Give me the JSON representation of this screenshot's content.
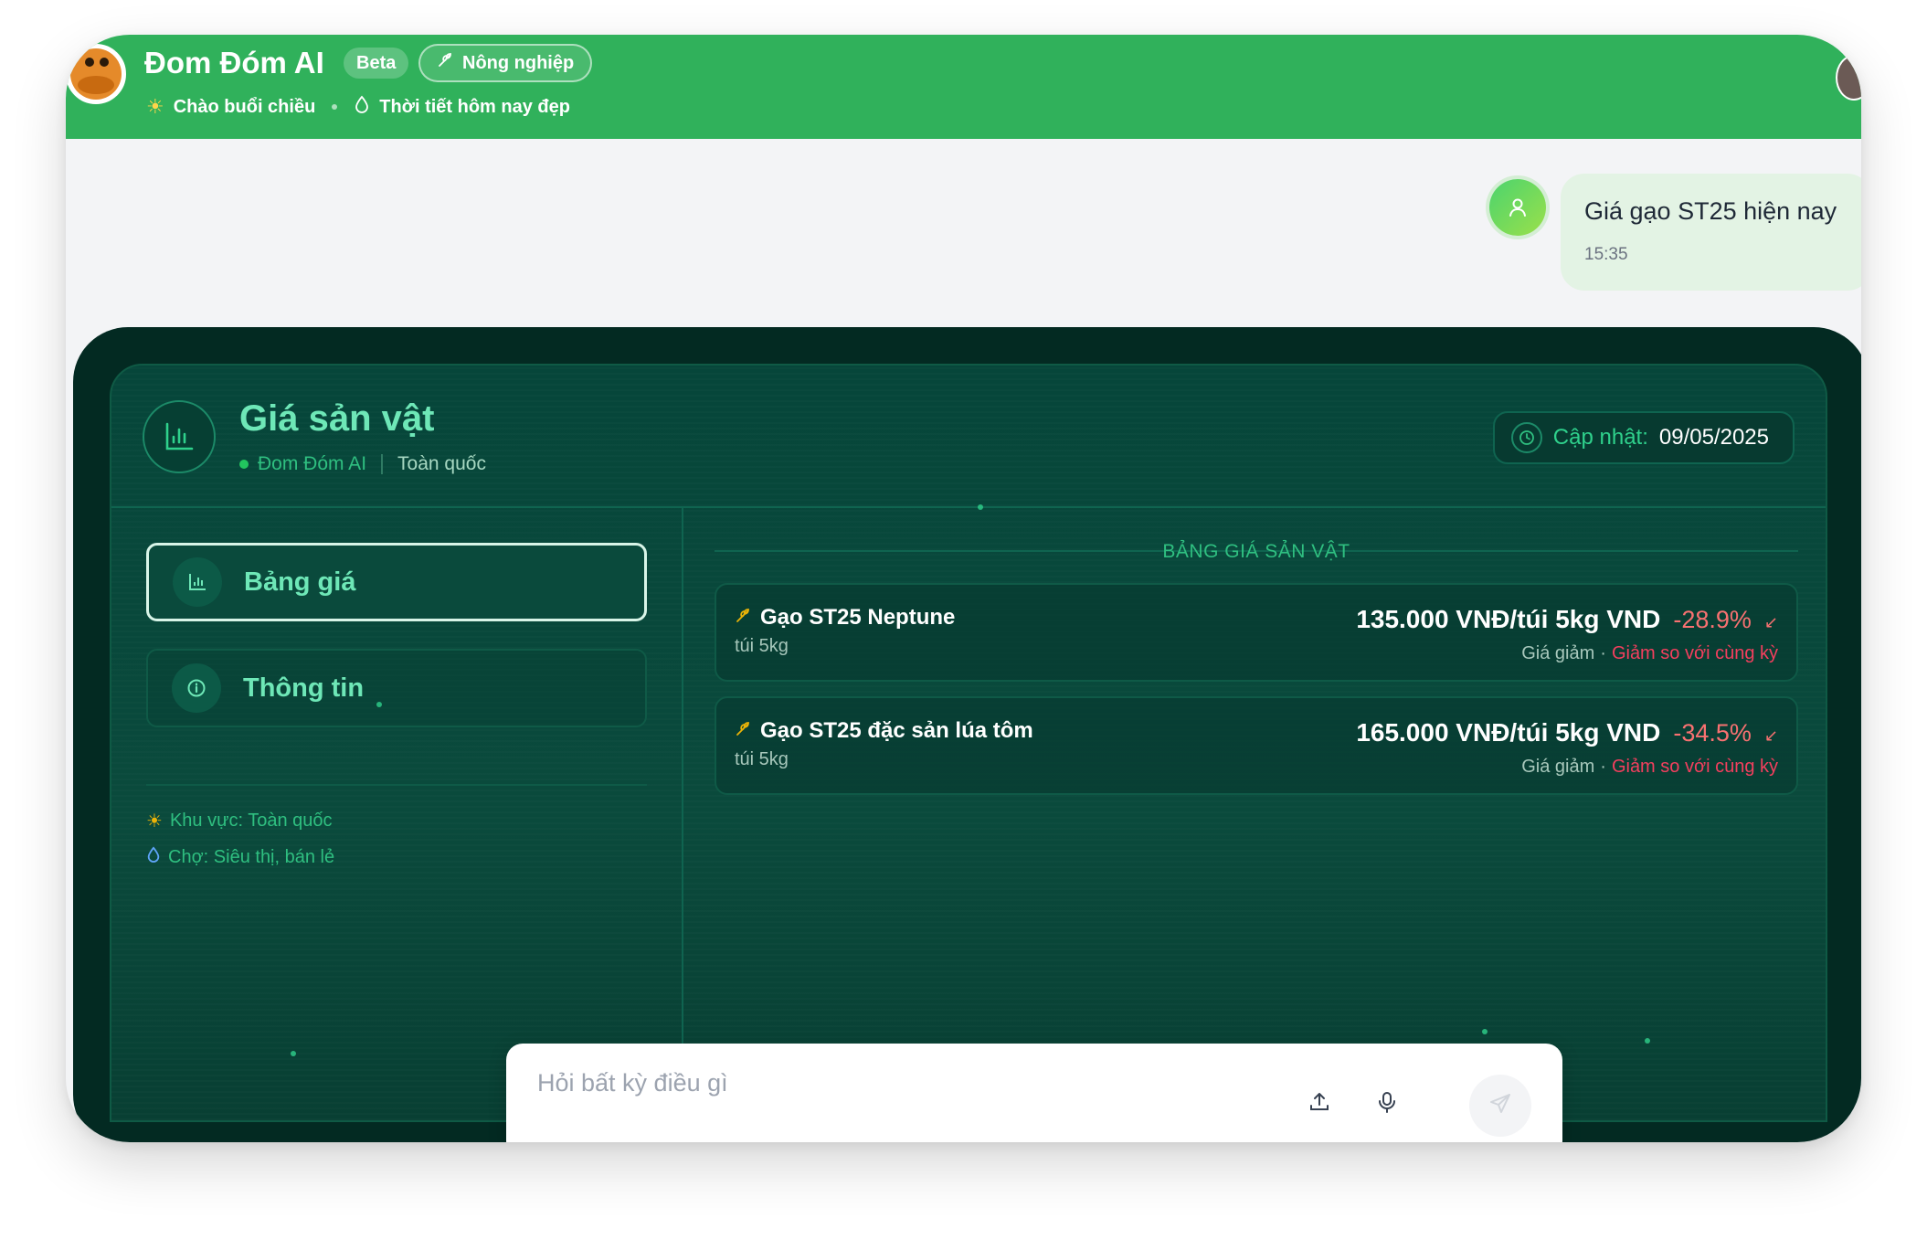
{
  "header": {
    "app_title": "Đom Đóm AI",
    "beta": "Beta",
    "category": "Nông nghiệp",
    "greeting": "Chào buổi chiều",
    "weather": "Thời tiết hôm nay đẹp",
    "accent_color": "#30b15b"
  },
  "chat": {
    "user_message": "Giá gạo ST25 hiện nay",
    "time": "15:35"
  },
  "panel": {
    "title": "Giá sản vật",
    "brand": "Đom Đóm AI",
    "region": "Toàn quốc",
    "update_label": "Cập nhật:",
    "update_date": "09/05/2025"
  },
  "nav": {
    "items": [
      {
        "label": "Bảng giá",
        "icon": "bar-chart-icon",
        "active": true
      },
      {
        "label": "Thông tin",
        "icon": "info-icon",
        "active": false
      }
    ],
    "meta": {
      "area": "Khu vực: Toàn quốc",
      "market": "Chợ: Siêu thị, bán lẻ"
    }
  },
  "table": {
    "heading": "BẢNG GIÁ SẢN VẬT",
    "rows": [
      {
        "name": "Gạo ST25 Neptune",
        "unit": "túi 5kg",
        "price": "135.000 VNĐ/túi 5kg VND",
        "change": "-28.9%",
        "trend": "Giá giảm",
        "trend_note": "Giảm so với cùng kỳ"
      },
      {
        "name": "Gạo ST25 đặc sản lúa tôm",
        "unit": "túi 5kg",
        "price": "165.000 VNĐ/túi 5kg VND",
        "change": "-34.5%",
        "trend": "Giá giảm",
        "trend_note": "Giảm so với cùng kỳ"
      }
    ]
  },
  "input": {
    "placeholder": "Hỏi bất kỳ điều gì"
  }
}
